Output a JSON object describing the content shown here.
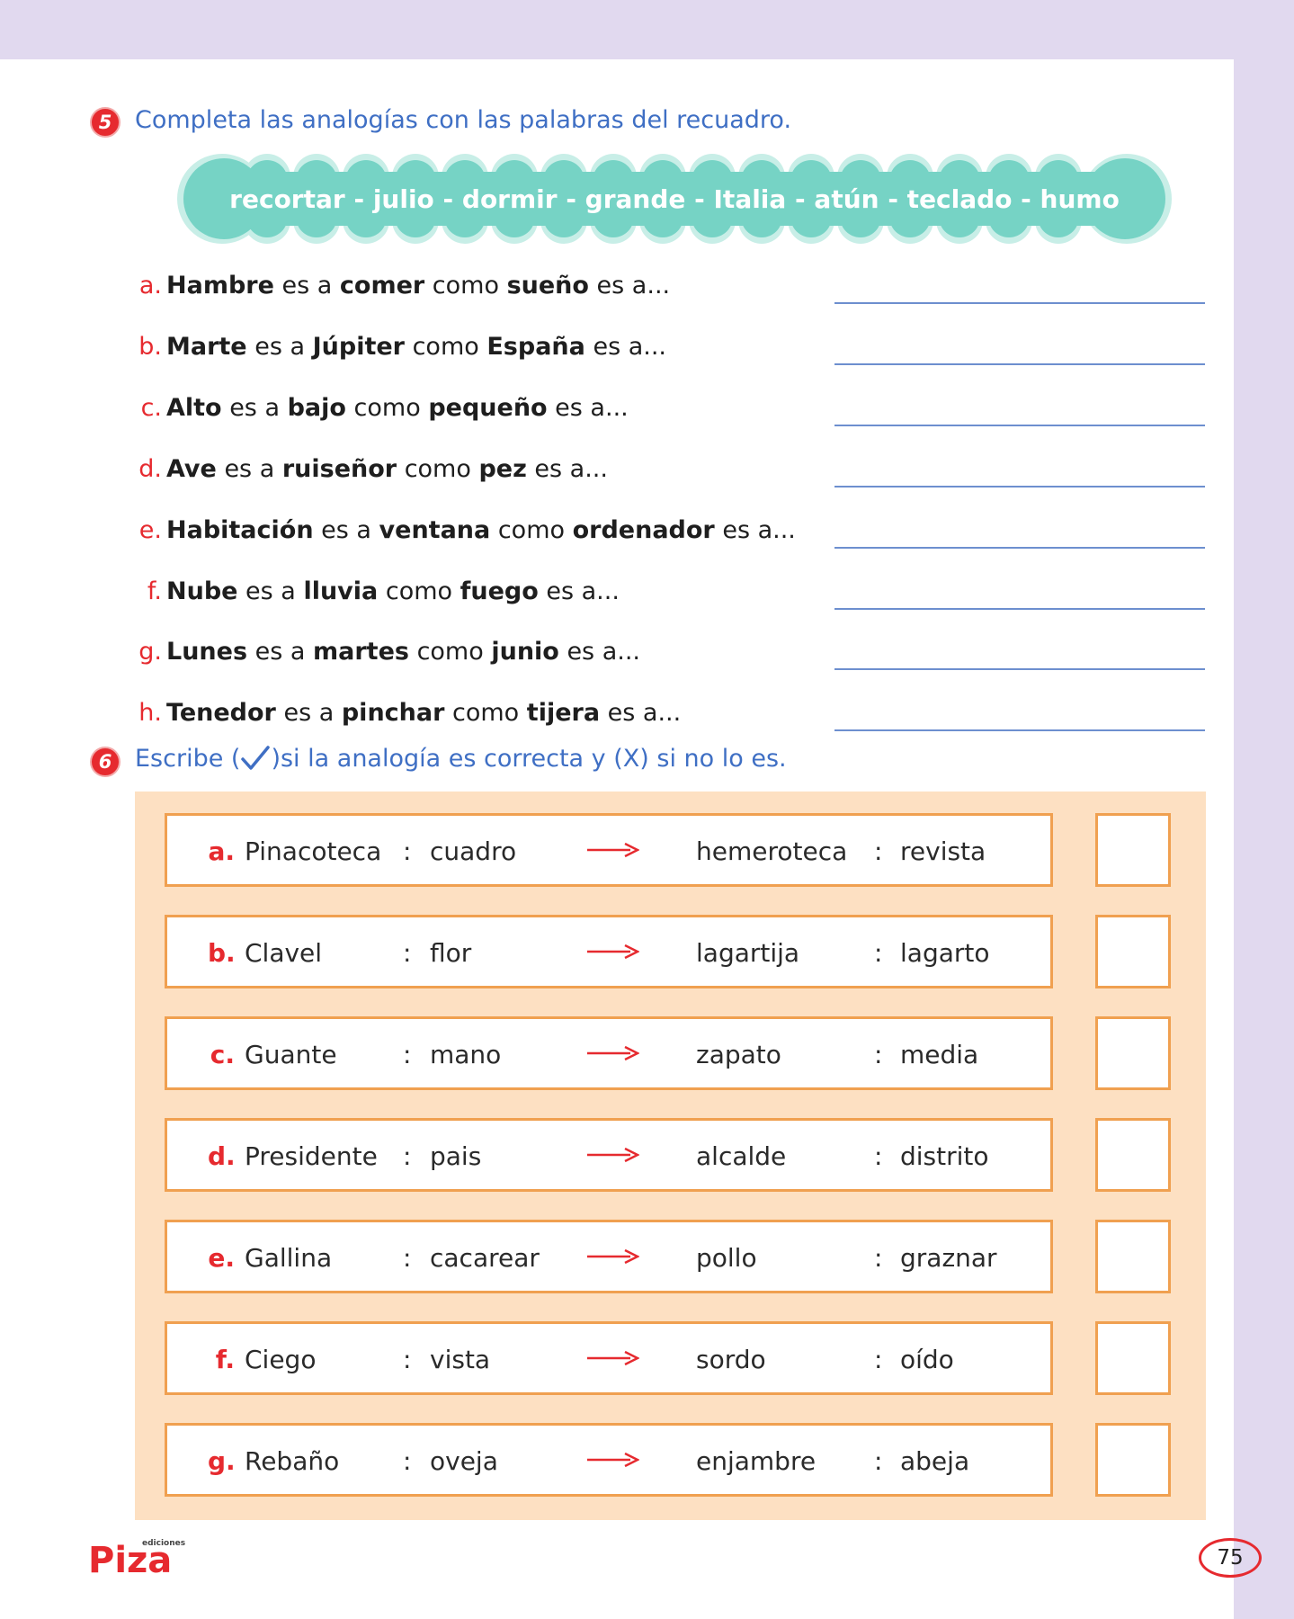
{
  "exercise5": {
    "number": "5",
    "instruction": "Completa las analogías con las palabras del recuadro.",
    "word_bank": "recortar - julio - dormir - grande - Italia - atún - teclado - humo",
    "items": [
      {
        "letter": "a.",
        "w1": "Hambre",
        "t1": " es a ",
        "w2": "comer",
        "t2": " como ",
        "w3": "sueño",
        "t3": " es a..."
      },
      {
        "letter": "b.",
        "w1": "Marte",
        "t1": " es a ",
        "w2": "Júpiter",
        "t2": " como ",
        "w3": "España",
        "t3": " es a..."
      },
      {
        "letter": "c.",
        "w1": "Alto",
        "t1": " es a ",
        "w2": "bajo",
        "t2": " como ",
        "w3": "pequeño",
        "t3": " es a..."
      },
      {
        "letter": "d.",
        "w1": "Ave",
        "t1": " es a ",
        "w2": "ruiseñor",
        "t2": " como ",
        "w3": "pez",
        "t3": " es a..."
      },
      {
        "letter": "e.",
        "w1": "Habitación",
        "t1": " es a ",
        "w2": "ventana",
        "t2": " como ",
        "w3": "ordenador",
        "t3": " es a..."
      },
      {
        "letter": "f.",
        "w1": "Nube",
        "t1": " es a ",
        "w2": "lluvia",
        "t2": " como ",
        "w3": "fuego",
        "t3": " es a..."
      },
      {
        "letter": "g.",
        "w1": "Lunes",
        "t1": " es a ",
        "w2": "martes",
        "t2": " como ",
        "w3": "junio",
        "t3": " es a..."
      },
      {
        "letter": "h.",
        "w1": "Tenedor",
        "t1": " es a ",
        "w2": "pinchar",
        "t2": " como ",
        "w3": "tijera",
        "t3": " es a..."
      }
    ]
  },
  "exercise6": {
    "number": "6",
    "instruction_pre": "Escribe (",
    "instruction_post": ")si la analogía es correcta y (X) si no lo es.",
    "colon": ":",
    "items": [
      {
        "letter": "a.",
        "a": "Pinacoteca",
        "b": "cuadro",
        "c": "hemeroteca",
        "d": "revista"
      },
      {
        "letter": "b.",
        "a": "Clavel",
        "b": "flor",
        "c": "lagartija",
        "d": "lagarto"
      },
      {
        "letter": "c.",
        "a": "Guante",
        "b": "mano",
        "c": "zapato",
        "d": "media"
      },
      {
        "letter": "d.",
        "a": "Presidente",
        "b": "pais",
        "c": "alcalde",
        "d": "distrito"
      },
      {
        "letter": "e.",
        "a": "Gallina",
        "b": "cacarear",
        "c": "pollo",
        "d": "graznar"
      },
      {
        "letter": "f.",
        "a": "Ciego",
        "b": "vista",
        "c": "sordo",
        "d": "oído"
      },
      {
        "letter": "g.",
        "a": "Rebaño",
        "b": "oveja",
        "c": "enjambre",
        "d": "abeja"
      }
    ]
  },
  "footer": {
    "logo_small": "ediciones",
    "logo_text": "Piza",
    "page_number": "75"
  },
  "colors": {
    "accent_red": "#e62a2f",
    "instruction_blue": "#3f6fc4",
    "wordbank_teal": "#76d3c5",
    "panel_peach": "#fde0c2",
    "border_orange": "#f0a050",
    "page_margin_lavender": "#e1d9ef"
  }
}
